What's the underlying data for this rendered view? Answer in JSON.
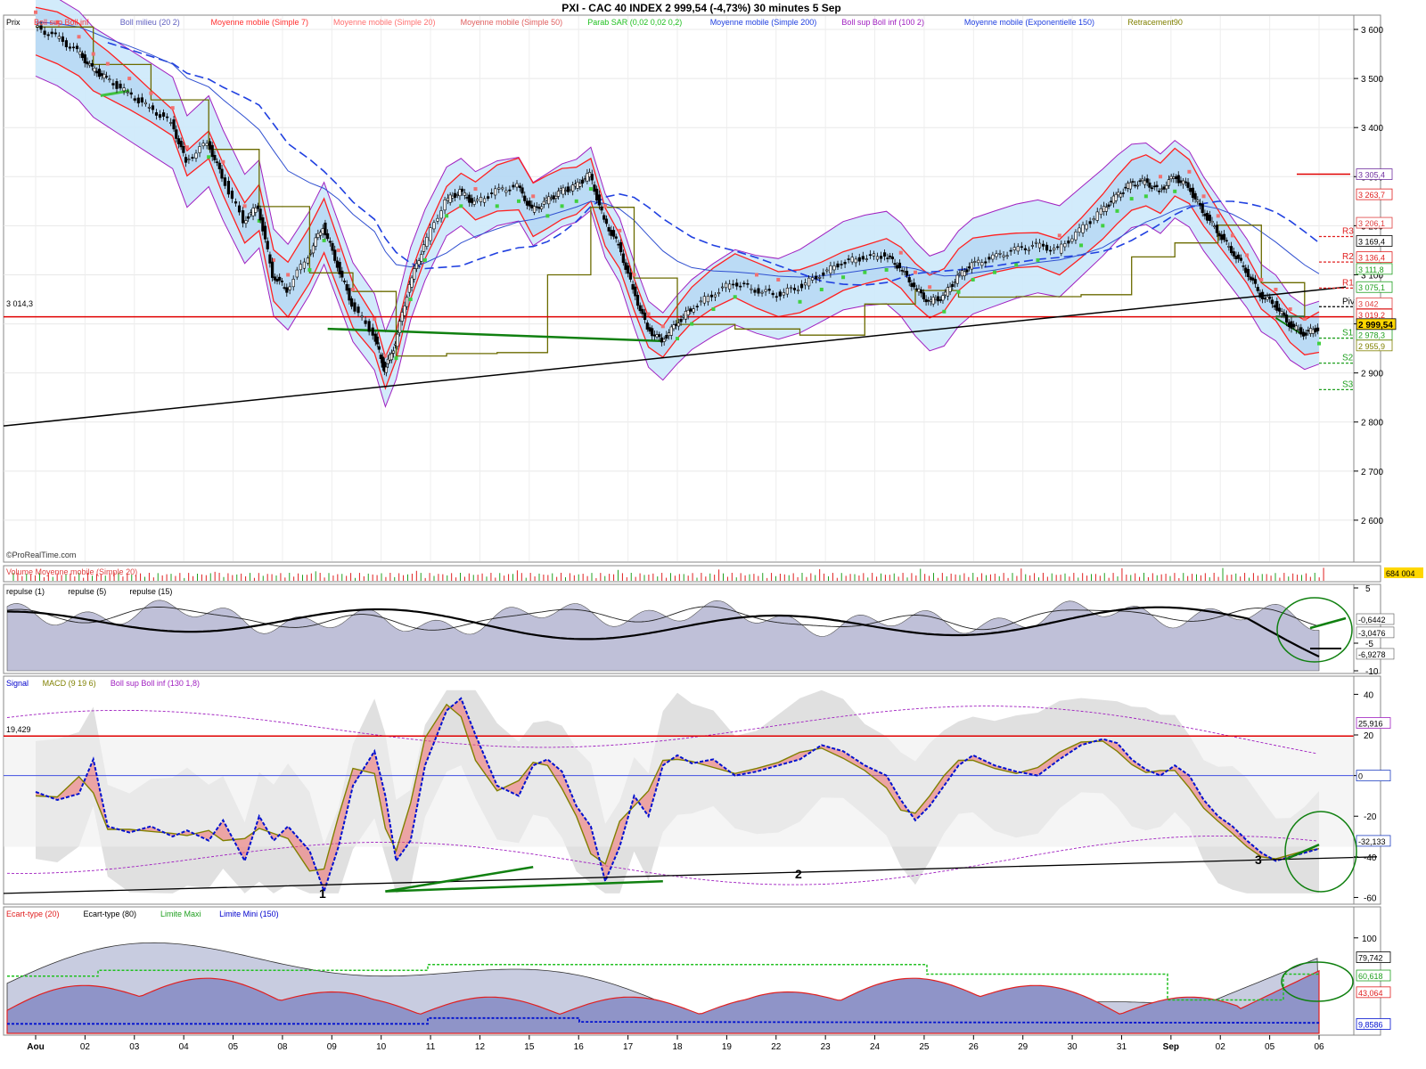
{
  "header": {
    "title": "PXI - CAC 40 INDEX     2 999,54 (-4,73%)     30 minutes  5 Sep"
  },
  "chart_data": [
    {
      "id": "price",
      "type": "candlestick",
      "panel_label": "Prix",
      "legend": [
        {
          "name": "Boll sup Boll inf",
          "color": "#ff3030"
        },
        {
          "name": "Boll milieu (20 2)",
          "color": "#6060c0"
        },
        {
          "name": "Moyenne mobile (Simple 7)",
          "color": "#ff3030"
        },
        {
          "name": "Moyenne mobile (Simple 20)",
          "color": "#ff7070"
        },
        {
          "name": "Moyenne mobile (Simple 50)",
          "color": "#e06060"
        },
        {
          "name": "Parab SAR (0,02 0,02 0,2)",
          "color": "#20c020"
        },
        {
          "name": "Moyenne mobile (Simple 200)",
          "color": "#2040e0"
        },
        {
          "name": "Boll sup Boll inf (100 2)",
          "color": "#a020c0"
        },
        {
          "name": "Moyenne mobile (Exponentielle 150)",
          "color": "#2040e0"
        },
        {
          "name": "Retracement90",
          "color": "#808000"
        }
      ],
      "ylim": [
        2520,
        3620
      ],
      "y_ticks": [
        2600,
        2700,
        2800,
        2900,
        3000,
        3100,
        3200,
        3300,
        3400,
        3500,
        3600
      ],
      "y_tick_labels": [
        "2 600",
        "2 700",
        "2 800",
        "2 900",
        "3 000",
        "3 100",
        "3 200",
        "3 300",
        "3 400",
        "3 500",
        "3 600"
      ],
      "x_dates": [
        "Aou",
        "02",
        "03",
        "04",
        "05",
        "08",
        "09",
        "10",
        "11",
        "12",
        "15",
        "16",
        "17",
        "18",
        "19",
        "22",
        "23",
        "24",
        "25",
        "26",
        "29",
        "30",
        "31",
        "Sep",
        "02",
        "05",
        "06"
      ],
      "close_path": [
        [
          0.0,
          3605
        ],
        [
          0.3,
          3585
        ],
        [
          0.6,
          3555
        ],
        [
          0.8,
          3520
        ],
        [
          1.0,
          3500
        ],
        [
          1.3,
          3470
        ],
        [
          1.6,
          3440
        ],
        [
          1.9,
          3410
        ],
        [
          2.1,
          3330
        ],
        [
          2.4,
          3370
        ],
        [
          2.6,
          3300
        ],
        [
          2.9,
          3210
        ],
        [
          3.1,
          3240
        ],
        [
          3.3,
          3100
        ],
        [
          3.5,
          3070
        ],
        [
          3.8,
          3140
        ],
        [
          4.0,
          3200
        ],
        [
          4.2,
          3120
        ],
        [
          4.4,
          3040
        ],
        [
          4.7,
          2980
        ],
        [
          4.85,
          2905
        ],
        [
          5.0,
          2960
        ],
        [
          5.2,
          3080
        ],
        [
          5.4,
          3160
        ],
        [
          5.7,
          3250
        ],
        [
          5.9,
          3270
        ],
        [
          6.1,
          3245
        ],
        [
          6.4,
          3270
        ],
        [
          6.7,
          3280
        ],
        [
          6.9,
          3230
        ],
        [
          7.1,
          3250
        ],
        [
          7.3,
          3270
        ],
        [
          7.5,
          3280
        ],
        [
          7.7,
          3305
        ],
        [
          7.9,
          3210
        ],
        [
          8.1,
          3160
        ],
        [
          8.3,
          3070
        ],
        [
          8.5,
          2990
        ],
        [
          8.7,
          2965
        ],
        [
          8.9,
          3000
        ],
        [
          9.1,
          3030
        ],
        [
          9.4,
          3060
        ],
        [
          9.7,
          3085
        ],
        [
          10.0,
          3070
        ],
        [
          10.3,
          3060
        ],
        [
          10.6,
          3075
        ],
        [
          10.9,
          3100
        ],
        [
          11.2,
          3125
        ],
        [
          11.5,
          3135
        ],
        [
          11.8,
          3140
        ],
        [
          12.0,
          3115
        ],
        [
          12.2,
          3075
        ],
        [
          12.4,
          3045
        ],
        [
          12.6,
          3055
        ],
        [
          12.8,
          3095
        ],
        [
          13.0,
          3120
        ],
        [
          13.3,
          3135
        ],
        [
          13.6,
          3150
        ],
        [
          13.9,
          3160
        ],
        [
          14.2,
          3150
        ],
        [
          14.5,
          3190
        ],
        [
          14.8,
          3230
        ],
        [
          15.0,
          3260
        ],
        [
          15.2,
          3285
        ],
        [
          15.4,
          3290
        ],
        [
          15.6,
          3270
        ],
        [
          15.8,
          3300
        ],
        [
          16.0,
          3280
        ],
        [
          16.2,
          3230
        ],
        [
          16.4,
          3190
        ],
        [
          16.6,
          3150
        ],
        [
          16.8,
          3110
        ],
        [
          17.0,
          3060
        ],
        [
          17.2,
          3040
        ],
        [
          17.4,
          3000
        ],
        [
          17.6,
          2980
        ],
        [
          17.8,
          2990
        ]
      ],
      "closing_value_label": "2 999,54",
      "level_labels": [
        {
          "text": "3 305,4",
          "value": 3305,
          "color": "#7030a0"
        },
        {
          "text": "3 263,7",
          "value": 3264,
          "color": "#e02020"
        },
        {
          "text": "3 206,1",
          "value": 3206,
          "color": "#e04040"
        },
        {
          "text": "3 169,4",
          "value": 3169,
          "color": "#000000"
        },
        {
          "text": "3 136,4",
          "value": 3136,
          "color": "#e02020"
        },
        {
          "text": "3 111,8",
          "value": 3112,
          "color": "#20a020"
        },
        {
          "text": "3 075,1",
          "value": 3075,
          "color": "#20a020"
        },
        {
          "text": "3 042",
          "value": 3042,
          "color": "#e04040"
        },
        {
          "text": "3 019,2",
          "value": 3019,
          "color": "#e02020"
        },
        {
          "text": "2 978,3",
          "value": 2978,
          "color": "#20a020"
        },
        {
          "text": "2 955,9",
          "value": 2956,
          "color": "#808000"
        }
      ],
      "pivots": [
        {
          "text": "R3",
          "value": 3178,
          "color": "#e02020"
        },
        {
          "text": "R2",
          "value": 3126,
          "color": "#e02020"
        },
        {
          "text": "R1",
          "value": 3073,
          "color": "#e02020"
        },
        {
          "text": "Piv",
          "value": 3035,
          "color": "#000000"
        },
        {
          "text": "S1",
          "value": 2971,
          "color": "#20a020"
        },
        {
          "text": "S2",
          "value": 2920,
          "color": "#20a020"
        },
        {
          "text": "S3",
          "value": 2866,
          "color": "#20a020"
        }
      ],
      "hline_label": "3 014,3",
      "hline_value": 3014.3,
      "watermark": "©ProRealTime.com"
    },
    {
      "id": "volume",
      "type": "bar",
      "panel_label": "Volume Moyenne mobile (Simple 20)",
      "last_value_label": "684 004"
    },
    {
      "id": "repulse",
      "type": "line",
      "series": [
        {
          "name": "repulse (1)"
        },
        {
          "name": "repulse (5)"
        },
        {
          "name": "repulse (15)"
        }
      ],
      "ylim": [
        -10,
        5
      ],
      "y_ticks": [
        5,
        -5,
        -10
      ],
      "y_tick_labels": [
        "5",
        "-5",
        "-10"
      ],
      "last_value_labels": [
        "-0,6442",
        "-3,0476",
        "-6,9278"
      ]
    },
    {
      "id": "macd",
      "type": "line",
      "legend": [
        {
          "name": "Signal",
          "color": "#0000cc"
        },
        {
          "name": "MACD (9 19 6)",
          "color": "#808000"
        },
        {
          "name": "Boll sup Boll inf (130 1,8)",
          "color": "#a020c0"
        }
      ],
      "ylim": [
        -62,
        45
      ],
      "y_ticks": [
        40,
        20,
        0,
        -20,
        -40,
        -60
      ],
      "y_tick_labels": [
        "40",
        "20",
        "",
        "-20",
        "-40",
        "-60"
      ],
      "hline_label": "19,429",
      "last_value_labels": [
        "25,916",
        "0",
        "-32,133"
      ],
      "x": [
        0,
        0.3,
        0.6,
        0.8,
        1.0,
        1.3,
        1.6,
        1.9,
        2.1,
        2.4,
        2.6,
        2.9,
        3.1,
        3.3,
        3.5,
        3.8,
        4.0,
        4.2,
        4.4,
        4.7,
        4.85,
        5.0,
        5.2,
        5.4,
        5.7,
        5.9,
        6.1,
        6.4,
        6.7,
        6.9,
        7.1,
        7.3,
        7.5,
        7.7,
        7.9,
        8.1,
        8.3,
        8.5,
        8.7,
        8.9,
        9.1,
        9.4,
        9.7,
        10.0,
        10.3,
        10.6,
        10.9,
        11.2,
        11.5,
        11.8,
        12.0,
        12.2,
        12.4,
        12.6,
        12.8,
        13.0,
        13.3,
        13.6,
        13.9,
        14.2,
        14.5,
        14.8,
        15.0,
        15.2,
        15.4,
        15.6,
        15.8,
        16.0,
        16.2,
        16.4,
        16.6,
        16.8,
        17.0,
        17.2,
        17.4,
        17.6,
        17.8
      ],
      "signal": [
        -8,
        -12,
        -9,
        8,
        -25,
        -28,
        -25,
        -30,
        -27,
        -32,
        -22,
        -42,
        -20,
        -32,
        -25,
        -37,
        -57,
        -35,
        -5,
        12,
        -10,
        -42,
        -32,
        5,
        32,
        38,
        20,
        -5,
        -10,
        5,
        8,
        2,
        -15,
        -25,
        -52,
        -35,
        -10,
        -20,
        5,
        10,
        6,
        8,
        0,
        2,
        5,
        8,
        15,
        12,
        5,
        0,
        -12,
        -22,
        -15,
        -5,
        5,
        10,
        5,
        2,
        0,
        8,
        15,
        18,
        16,
        8,
        3,
        0,
        5,
        0,
        -12,
        -20,
        -25,
        -32,
        -38,
        -42,
        -40,
        -38,
        -36
      ],
      "annotations": [
        "1",
        "2",
        "3"
      ]
    },
    {
      "id": "stddev",
      "type": "area",
      "legend": [
        {
          "name": "Ecart-type (20)",
          "color": "#e02020"
        },
        {
          "name": "Ecart-type (80)",
          "color": "#000000"
        },
        {
          "name": "Limite Maxi",
          "color": "#20a020"
        },
        {
          "name": "Limite Mini (150)",
          "color": "#0000cc"
        }
      ],
      "ylim": [
        0,
        125
      ],
      "y_ticks": [
        100
      ],
      "y_tick_labels": [
        "100"
      ],
      "last_value_labels": [
        "79,742",
        "60,618",
        "43,064",
        "9,8586"
      ]
    }
  ]
}
